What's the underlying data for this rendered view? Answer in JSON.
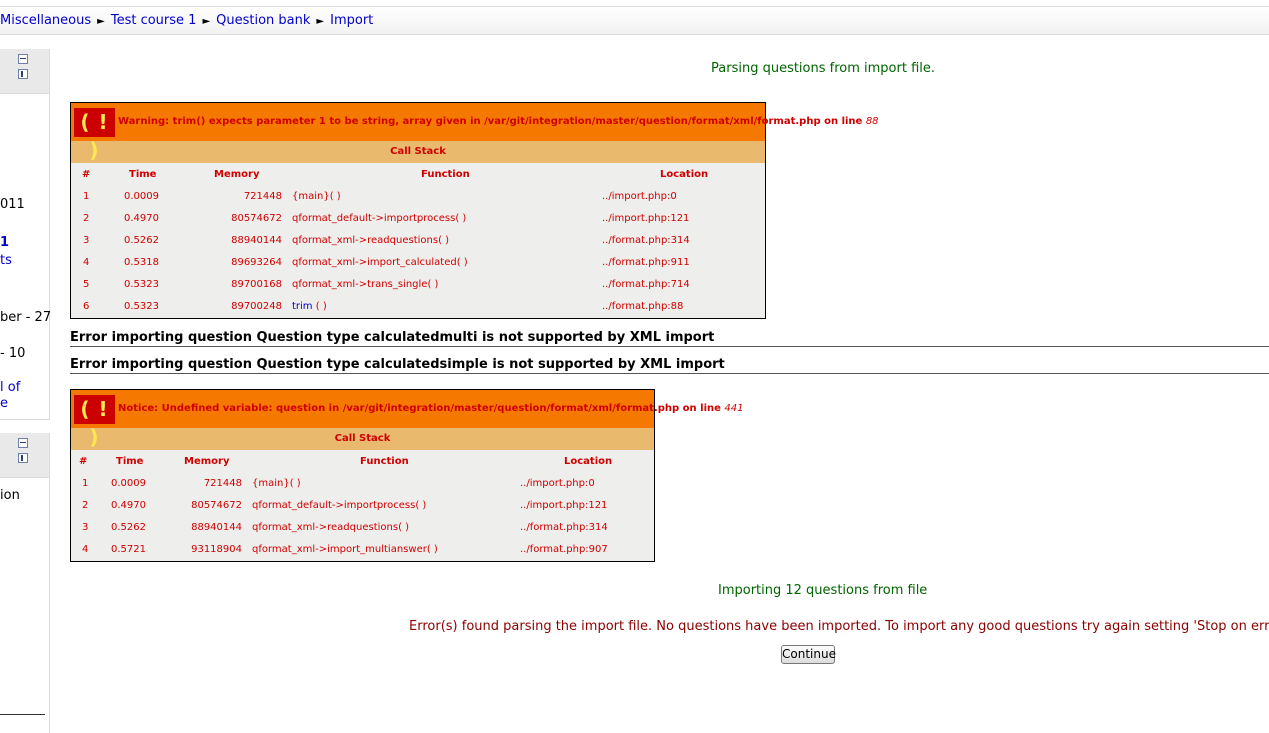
{
  "breadcrumb": {
    "items": [
      "Miscellaneous",
      "Test course 1",
      "Question bank",
      "Import"
    ],
    "separator": "►"
  },
  "left_blocks": {
    "fragments": [
      "011",
      "1",
      "ts",
      "ber - 27",
      "- 10",
      "l of",
      "e",
      "ion"
    ]
  },
  "status": {
    "parsing": "Parsing questions from import file.",
    "importing": "Importing 12 questions from file",
    "error_found": "Error(s) found parsing the import file. No questions have been imported. To import any good questions try again setting 'Stop on error' to 'No'"
  },
  "warning1": {
    "icon": "( ! )",
    "message": "Warning: trim() expects parameter 1 to be string, array given in /var/git/integration/master/question/format/xml/format.php on line ",
    "line": "88",
    "call_stack_label": "Call Stack",
    "columns": [
      "#",
      "Time",
      "Memory",
      "Function",
      "Location"
    ],
    "rows": [
      {
        "n": "1",
        "time": "0.0009",
        "mem": "721448",
        "fn": "{main}( )",
        "loc": "../import.php:0"
      },
      {
        "n": "2",
        "time": "0.4970",
        "mem": "80574672",
        "fn": "qformat_default->importprocess( )",
        "loc": "../import.php:121"
      },
      {
        "n": "3",
        "time": "0.5262",
        "mem": "88940144",
        "fn": "qformat_xml->readquestions( )",
        "loc": "../format.php:314"
      },
      {
        "n": "4",
        "time": "0.5318",
        "mem": "89693264",
        "fn": "qformat_xml->import_calculated( )",
        "loc": "../format.php:911"
      },
      {
        "n": "5",
        "time": "0.5323",
        "mem": "89700168",
        "fn": "qformat_xml->trans_single( )",
        "loc": "../format.php:714"
      },
      {
        "n": "6",
        "time": "0.5323",
        "mem": "89700248",
        "fn_link": "trim",
        "fn_rest": " ( )",
        "loc": "../format.php:88"
      }
    ]
  },
  "errors": [
    "Error importing question Question type calculatedmulti is not supported by XML import",
    "Error importing question Question type calculatedsimple is not supported by XML import"
  ],
  "warning2": {
    "icon": "( ! )",
    "message": "Notice: Undefined variable: question in /var/git/integration/master/question/format/xml/format.php on line ",
    "line": "441",
    "call_stack_label": "Call Stack",
    "columns": [
      "#",
      "Time",
      "Memory",
      "Function",
      "Location"
    ],
    "rows": [
      {
        "n": "1",
        "time": "0.0009",
        "mem": "721448",
        "fn": "{main}( )",
        "loc": "../import.php:0"
      },
      {
        "n": "2",
        "time": "0.4970",
        "mem": "80574672",
        "fn": "qformat_default->importprocess( )",
        "loc": "../import.php:121"
      },
      {
        "n": "3",
        "time": "0.5262",
        "mem": "88940144",
        "fn": "qformat_xml->readquestions( )",
        "loc": "../format.php:314"
      },
      {
        "n": "4",
        "time": "0.5721",
        "mem": "93118904",
        "fn": "qformat_xml->import_multianswer( )",
        "loc": "../format.php:907"
      }
    ]
  },
  "buttons": {
    "continue": "Continue"
  }
}
